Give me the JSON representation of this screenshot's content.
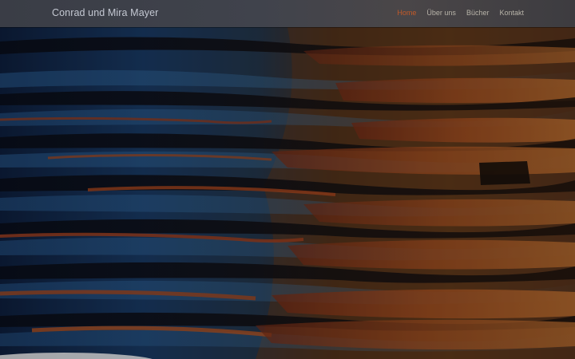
{
  "header": {
    "site_title": "Conrad und Mira Mayer",
    "nav": [
      {
        "label": "Home",
        "active": true
      },
      {
        "label": "Über uns",
        "active": false
      },
      {
        "label": "Bücher",
        "active": false
      },
      {
        "label": "Kontakt",
        "active": false
      }
    ]
  },
  "colors": {
    "accent": "#c35a28",
    "header_bg": "#3f424a",
    "nav_text": "#b7b3a8"
  },
  "hero": {
    "image": "water-ripples-sunset-photo"
  }
}
